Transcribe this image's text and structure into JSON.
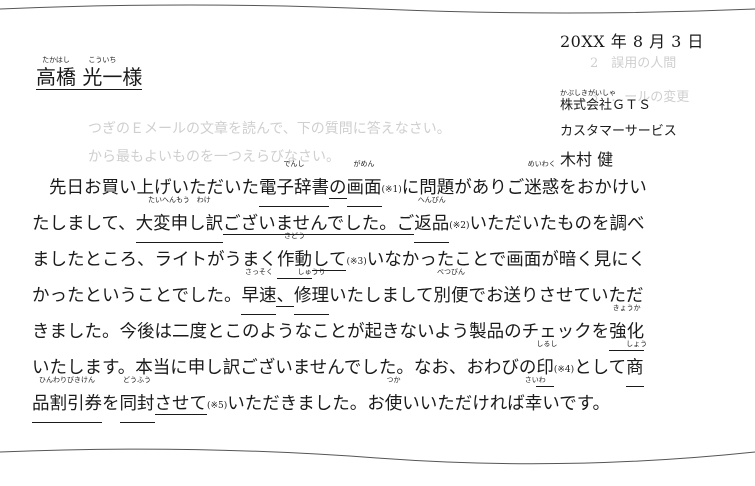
{
  "letter": {
    "date": "20XX 年 8 月 3 日",
    "recipient": {
      "family_name": "高橋",
      "family_ruby": "たかはし",
      "given_name": "光一",
      "given_ruby": "こういち",
      "honorific": "様"
    },
    "sender": {
      "company_ruby": "かぶしきがいしゃ",
      "company": "株式会社ＧＴＳ",
      "department": "カスタマーサービス",
      "name": "木村 健"
    },
    "body": {
      "line1": {
        "a": "先日お買い上げいただいた",
        "b": "電子辞書",
        "b_ruby": "でんし",
        "c": "の",
        "d": "画面",
        "d_ruby": "がめん",
        "ref": "(※1)",
        "e": "に問題がありご",
        "f": "迷惑",
        "f_ruby": "めいわく",
        "g": "をおかけい"
      },
      "line2": {
        "a": "たしまして、",
        "b": "大変申し訳",
        "b_ruby": "たいへんもう　わけ",
        "c": "ございませんでした。ご",
        "d": "返品",
        "d_ruby": "へんぴん",
        "ref": "(※2)",
        "e": "いただいたものを調べ"
      },
      "line3": {
        "a": "ましたところ、ライトがうまく",
        "b": "作動",
        "b_ruby": "さどう",
        "c": "して",
        "ref": "(※3)",
        "d": "いなかったことで画面が暗く見にく"
      },
      "line4": {
        "a": "かったということでした。",
        "b": "早速",
        "b_ruby": "さっそく",
        "c": "、",
        "d": "修理",
        "d_ruby": "しゅうり",
        "e": "いたしまして",
        "f": "別便",
        "f_ruby": "べつびん",
        "g": "でお送りさせていただ"
      },
      "line5": {
        "a": "きました。今後は二度とこのようなことが起きないよう製品のチェックを",
        "b": "強化",
        "b_ruby": "きょうか"
      },
      "line6": {
        "a": "いたします。本当に申し訳ございませんでした。なお、おわびの",
        "b": "印",
        "b_ruby": "しるし",
        "ref": "(※4)",
        "c": "として",
        "d": "商",
        "d_ruby": "しょう"
      },
      "line7": {
        "a": "品割引券",
        "a_ruby": "ひんわりびきけん",
        "b": "を",
        "c": "同封",
        "c_ruby": "どうふう",
        "d": "させて",
        "ref": "(※5)",
        "e": "いただきました。お",
        "f": "使",
        "f_ruby": "つか",
        "g": "いいただければ",
        "h": "幸",
        "h_ruby": "さいわ",
        "i": "いです。"
      }
    }
  },
  "background": {
    "q2": "2　誤用の人間",
    "q3": "3　…ールの変更",
    "question": "つぎのＥメールの文章を読んで、下の質問に答えなさい。",
    "question2": "から最もよいものを一つえらびなさい。"
  }
}
